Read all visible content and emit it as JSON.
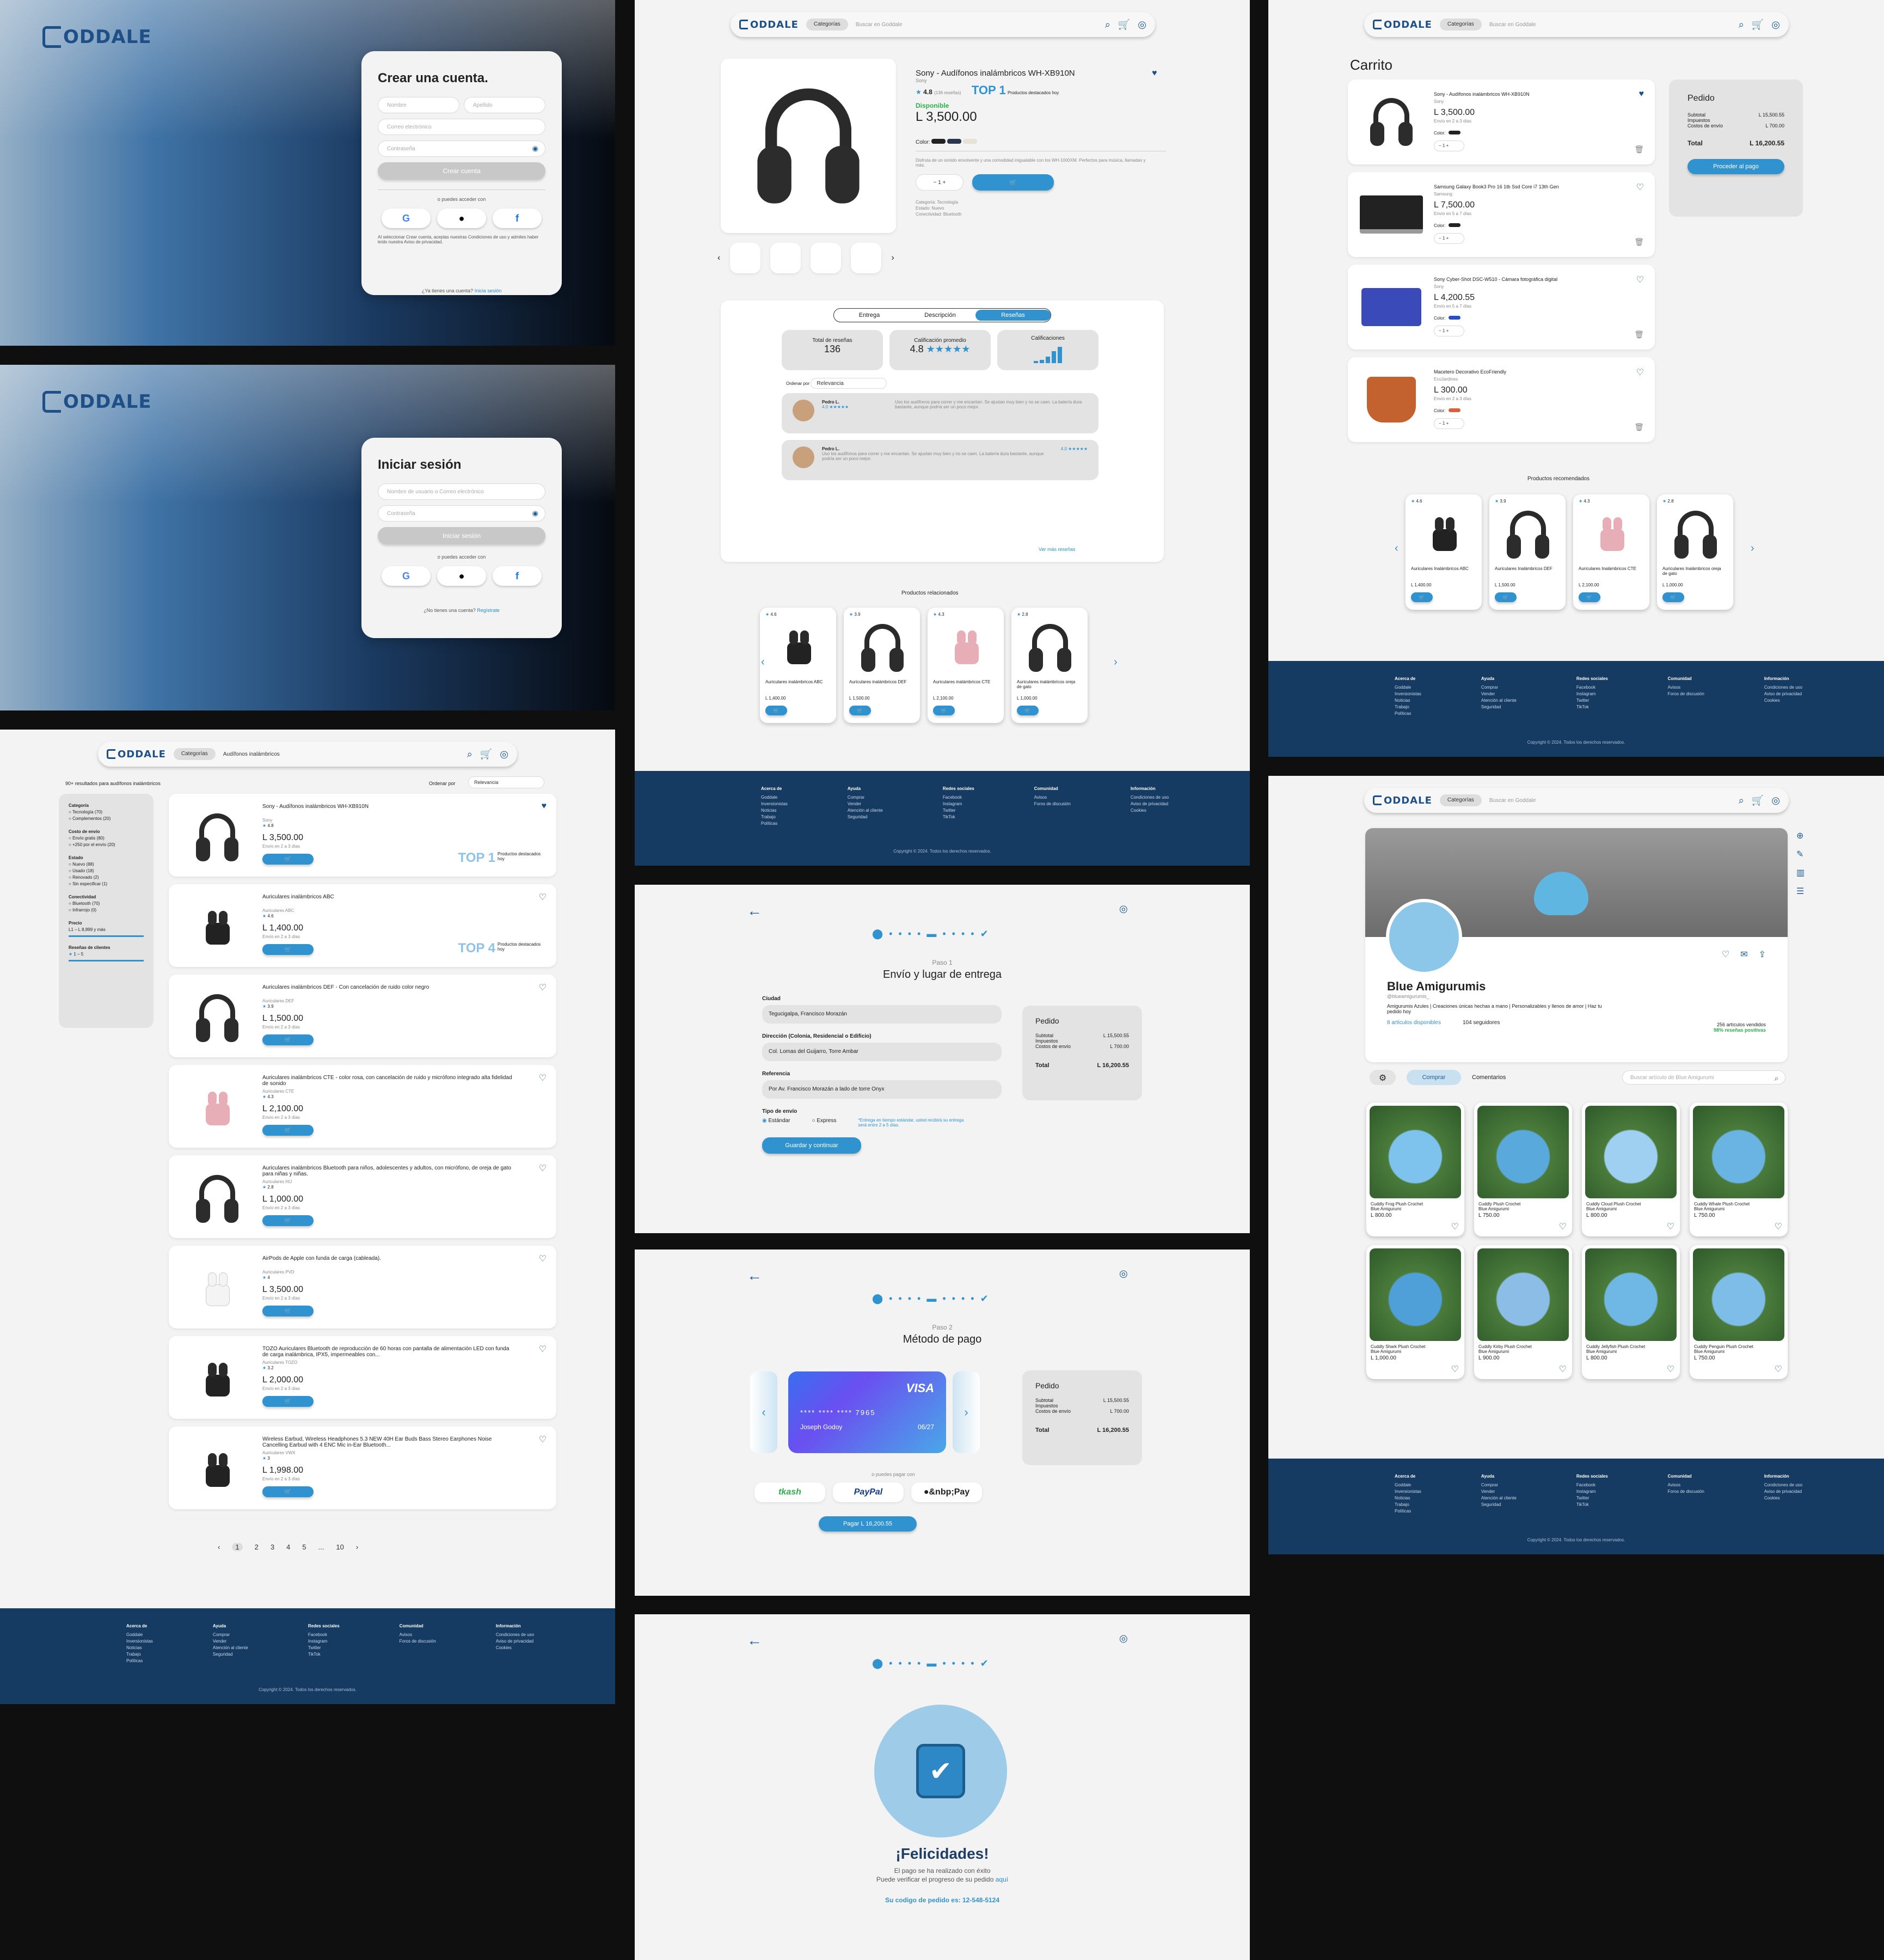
{
  "brand": {
    "name": "ODDALE"
  },
  "signup": {
    "title": "Crear una cuenta.",
    "nombre_ph": "Nombre",
    "apellido_ph": "Apellido",
    "email_ph": "Correo electrónico",
    "password_ph": "Contraseña",
    "btn": "Crear cuenta",
    "alt": "o puedes acceder con",
    "terms": "Al seleccionar Crear cuenta, aceptas nuestras Condiciones de uso y admites haber leído nuestra Aviso de privacidad.",
    "have_account": "¿Ya tienes una cuenta?",
    "have_account_link": "Inicia sesión"
  },
  "login": {
    "title": "Iniciar sesión",
    "user_ph": "Nombre de usuario o Correo electrónico",
    "password_ph": "Contraseña",
    "btn": "Iniciar sesión",
    "alt": "o puedes acceder con",
    "no_account": "¿No tienes una cuenta?",
    "no_account_link": "Regístrate"
  },
  "search_page": {
    "category_btn": "Categorías",
    "query": "Audífonos inalámbricos",
    "results": "90+ resultados para audífonos inalámbricos",
    "order_label": "Ordenar por",
    "order_value": "Relevancia",
    "filters": {
      "categoria": "Categoría",
      "cat_items": [
        "Tecnología (70)",
        "Complementos (20)"
      ],
      "costo": "Costo de envío",
      "costo_items": [
        "Envío gratis (80)",
        "+250 por el envío (20)"
      ],
      "estado": "Estado",
      "estado_items": [
        "Nuevo (88)",
        "Usado (18)",
        "Renovado (2)",
        "Sin especificar (1)"
      ],
      "conect": "Conectividad",
      "conect_items": [
        "Bluetooth (70)",
        "Infrarrojo (0)"
      ],
      "precio": "Precio",
      "precio_range": "L1 – L 8,899 y más",
      "resenas": "Reseñas de clientes",
      "resenas_val": "1 – 5"
    },
    "items": [
      {
        "title": "Sony - Audífonos inalámbricos WH-XB910N",
        "brand": "Sony",
        "rating": "4.8",
        "price": "L 3,500.00",
        "ship": "Envío en 2 a 3 días",
        "top": "TOP 1",
        "top_label": "Productos destacados hoy"
      },
      {
        "title": "Auriculares inalámbricos ABC",
        "brand": "Auriculares ABC",
        "rating": "4.6",
        "price": "L 1,400.00",
        "ship": "Envío en 2 a 3 días",
        "top": "TOP 4",
        "top_label": "Productos destacados hoy"
      },
      {
        "title": "Auriculares inalámbricos DEF - Con cancelación de ruido color negro",
        "brand": "Auriculares DEF",
        "rating": "3.9",
        "price": "L 1,500.00",
        "ship": "Envío en 2 a 3 días",
        "top": "",
        "top_label": ""
      },
      {
        "title": "Auriculares inalámbricos CTE - color rosa, con cancelación de ruido y micrófono integrado alta fidelidad de sonido",
        "brand": "Auriculares CTE",
        "rating": "4.3",
        "price": "L 2,100.00",
        "ship": "Envío en 2 a 3 días",
        "top": "",
        "top_label": ""
      },
      {
        "title": "Auriculares inalámbricos Bluetooth para niños, adolescentes y adultos, con micrófono, de oreja de gato para niñas y niñas.",
        "brand": "Auriculares HIJ",
        "rating": "2.8",
        "price": "L 1,000.00",
        "ship": "Envío en 2 a 3 días",
        "top": "",
        "top_label": ""
      },
      {
        "title": "AirPods de Apple con funda de carga (cableada).",
        "brand": "Auriculares PVD",
        "rating": "4",
        "price": "L 3,500.00",
        "ship": "Envío en 2 a 3 días",
        "top": "",
        "top_label": ""
      },
      {
        "title": "TOZO Auriculares Bluetooth de reproducción de 60 horas con pantalla de alimentación LED con funda de carga inalámbrica, IPX5, impermeables con...",
        "brand": "Auriculares TOZO",
        "rating": "3.2",
        "price": "L 2,000.00",
        "ship": "Envío en 2 a 3 días",
        "top": "",
        "top_label": ""
      },
      {
        "title": "Wireless Earbud, Wireless Headphones 5.3 NEW 40H Ear Buds Bass Stereo Earphones Noise Cancelling Earbud with 4 ENC Mic in-Ear Bluetooth...",
        "brand": "Auriculares VWX",
        "rating": "3",
        "price": "L 1,998.00",
        "ship": "Envío en 2 a 3 días",
        "top": "",
        "top_label": ""
      }
    ],
    "pages": [
      "1",
      "2",
      "3",
      "4",
      "5",
      "...",
      "10"
    ]
  },
  "search_placeholder": "Buscar en Goddale",
  "product": {
    "title": "Sony - Audífonos inalámbricos WH-XB910N",
    "brand": "Sony",
    "rating": "4.8",
    "reviews": "(136 reseñas)",
    "top": "TOP 1",
    "top_label": "Productos destacados hoy",
    "stock": "Disponible",
    "price": "L 3,500.00",
    "color_label": "Color:",
    "desc": "Disfruta de un sonido envolvente y una comodidad inigualable con los WH-1000XM. Perfectos para música, llamadas y más.",
    "qty": "1",
    "meta_cat": "Categoría: Tecnología",
    "meta_state": "Estado: Nuevo",
    "meta_conn": "Conectividad: Bluetooth",
    "tabs": [
      "Entrega",
      "Descripción",
      "Reseñas"
    ],
    "total_label": "Total de reseñas",
    "total": "136",
    "avg_label": "Calificación promedio",
    "avg": "4.8",
    "calif_label": "Calificaciones",
    "order_label": "Ordenar por",
    "order_value": "Relevancia",
    "review1_name": "Pedro L.",
    "review1_text": "Uso los audífonos para correr y me encantan. Se ajustan muy bien y no se caen. La batería dura bastante, aunque podría ser un poco mejor.",
    "review2_name": "Pedro L.",
    "review2_text": "Uso los audífonos para correr y me encantan. Se ajustan muy bien y no se caen. La batería dura bastante, aunque podría ser un poco mejor.",
    "review_score": "4.0",
    "more": "Ver más reseñas",
    "related_title": "Productos relacionados",
    "related": [
      {
        "rating": "4.6",
        "name": "Auriculares inalámbricos ABC",
        "price": "L 1,400.00"
      },
      {
        "rating": "3.9",
        "name": "Auriculares inalámbricos DEF",
        "price": "L 1,500.00"
      },
      {
        "rating": "4.3",
        "name": "Auriculares inalámbricos CTE",
        "price": "L 2,100.00"
      },
      {
        "rating": "2.8",
        "name": "Auriculares inalámbricos oreja de gato",
        "price": "L 1,000.00"
      }
    ]
  },
  "footer": {
    "c1_t": "Acerca de",
    "c1": [
      "Goddale",
      "Inversionistas",
      "Noticias",
      "Trabajo",
      "Políticas"
    ],
    "c2_t": "Ayuda",
    "c2": [
      "Comprar",
      "Vender",
      "Atención al cliente",
      "Seguridad"
    ],
    "c3_t": "Redes sociales",
    "c3": [
      "Facebook",
      "Instagram",
      "Twitter",
      "TikTok"
    ],
    "c4_t": "Comunidad",
    "c4": [
      "Avisos",
      "Foros de discusión"
    ],
    "c5_t": "Información",
    "c5": [
      "Condiciones de uso",
      "Aviso de privacidad",
      "Cookies"
    ],
    "copy": "Copyright © 2024. Todos los derechos reservados."
  },
  "step1": {
    "step": "Paso 1",
    "title": "Envío y lugar de entrega",
    "ciudad_l": "Ciudad",
    "ciudad": "Tegucigalpa, Francisco Morazán",
    "dir_l": "Dirección (Colonia, Residencial o Edificio)",
    "dir": "Col. Lomas del Guijarro, Torre Ambar",
    "ref_l": "Referencia",
    "ref": "Por Av. Francisco Morazán a lado de torre Onyx",
    "tipo_l": "Tipo de envío",
    "std": "Estándar",
    "exp": "Express",
    "note": "*Entrega en tiempo estándar, usted recibirá su entrega será entre 2 a 5 días.",
    "btn": "Guardar y continuar"
  },
  "order": {
    "title": "Pedido",
    "sub_l": "Subtotal",
    "sub": "L 15,500.55",
    "imp_l": "Impuestos",
    "env_l": "Costos de envío",
    "env": "L 700.00",
    "tot_l": "Total",
    "tot": "L 16,200.55"
  },
  "step2": {
    "step": "Paso 2",
    "title": "Método de pago",
    "card_brand": "VISA",
    "card_num": "**** **** **** 7965",
    "card_name": "Joseph Godoy",
    "card_exp": "06/27",
    "alt": "o puedes pagar con",
    "pay_opts": [
      "tkash",
      "PayPal",
      "Pay"
    ],
    "btn": "Pagar L 16,200.55"
  },
  "step3": {
    "title": "¡Felicidades!",
    "l1": "El pago se ha realizado con éxito",
    "l2": "Puede verificar el progreso de su pedido",
    "l2_link": "aquí",
    "code": "Su codigo de pedido es: 12-548-5124"
  },
  "cart": {
    "title": "Carrito",
    "items": [
      {
        "name": "Sony - Audífonos inalámbricos WH-XB910N",
        "brand": "Sony",
        "price": "L 3,500.00",
        "ship": "Envío en 2 a 3 días",
        "qty": "1"
      },
      {
        "name": "Samsung Galaxy Book3 Pro 16 1tb Ssd Core i7 13th Gen",
        "brand": "Samsung",
        "price": "L 7,500.00",
        "ship": "Envío en 5 a 7 días",
        "qty": "1"
      },
      {
        "name": "Sony Cyber-Shot DSC-W510 - Cámara fotográfica digital",
        "brand": "Sony",
        "price": "L 4,200.55",
        "ship": "Envío en 5 a 7 días",
        "qty": "1"
      },
      {
        "name": "Macetero Decorativo EcoFriendly",
        "brand": "EcoJardines",
        "price": "L 300.00",
        "ship": "Envío en 2 a 3 días",
        "qty": "1"
      }
    ],
    "color_label": "Color:",
    "checkout": "Proceder al pago",
    "rec_title": "Productos recomendados",
    "rec": [
      {
        "rating": "4.6",
        "name": "Auriculares Inalámbricos ABC",
        "price": "L 1,400.00"
      },
      {
        "rating": "3.9",
        "name": "Auriculares Inalámbricos DEF",
        "price": "L 1,500.00"
      },
      {
        "rating": "4.3",
        "name": "Auriculares Inalámbricos CTE",
        "price": "L 2,100.00"
      },
      {
        "rating": "2.8",
        "name": "Auriculares Inalámbricos oreja de gato",
        "price": "L 1,000.00"
      }
    ]
  },
  "store": {
    "name": "Blue Amigurumis",
    "handle": "@blueamigurumis_",
    "desc": "Amigurumis Azules | Creaciones únicas hechas a mano | Personalizables y llenos de amor | Haz tu pedido hoy",
    "items_count": "8 artículos disponibles",
    "followers": "104 seguidores",
    "sold": "256 artículos vendidos",
    "positive": "98% reseñas positivas",
    "tab_buy": "Comprar",
    "tab_comments": "Comentarios",
    "search_ph": "Buscar artículo de Blue Amigurumi",
    "products": [
      {
        "name": "Cuddly Frog Plush Crochet",
        "seller": "Blue Amigurumi",
        "price": "L 800.00"
      },
      {
        "name": "Cuddly Plush Crochet",
        "seller": "Blue Amigurumi",
        "price": "L 750.00"
      },
      {
        "name": "Cuddly Cloud Plush Crochet",
        "seller": "Blue Amigurumi",
        "price": "L 800.00"
      },
      {
        "name": "Cuddly Whale Plush Crochet",
        "seller": "Blue Amigurumi",
        "price": "L 750.00"
      },
      {
        "name": "Cuddly Shark Plush Crochet",
        "seller": "Blue Amigurumi",
        "price": "L 1,000.00"
      },
      {
        "name": "Cuddly Kirby Plush Crochet",
        "seller": "Blue Amigurumi",
        "price": "L 900.00"
      },
      {
        "name": "Cuddly Jellyfish Plush Crochet",
        "seller": "Blue Amigurumi",
        "price": "L 800.00"
      },
      {
        "name": "Cuddly Penguin Plush Crochet",
        "seller": "Blue Amigurumi",
        "price": "L 750.00"
      }
    ]
  }
}
